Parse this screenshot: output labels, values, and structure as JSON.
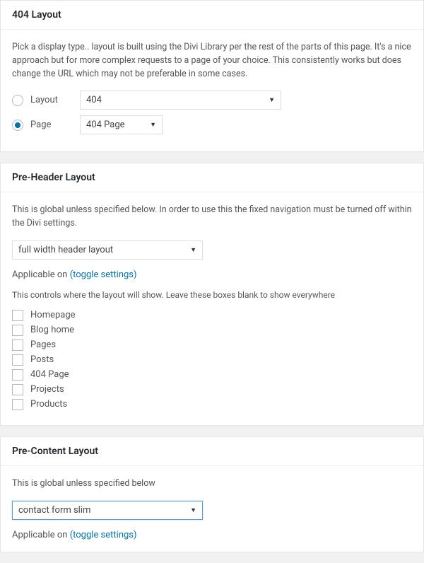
{
  "section404": {
    "title": "404 Layout",
    "description": "Pick a display type.. layout is built using the Divi Library per the rest of the parts of this page. It's a nice approach but for more complex requests to a page of your choice. This consistently works but does change the URL which may not be preferable in some cases.",
    "radioLayout": "Layout",
    "radioPage": "Page",
    "selectLayoutValue": "404",
    "selectPageValue": "404 Page"
  },
  "preHeader": {
    "title": "Pre-Header Layout",
    "description": "This is global unless specified below. In order to use this the fixed navigation must be turned off within the Divi settings.",
    "selectValue": "full width header layout",
    "applicablePrefix": "Applicable on ",
    "toggleText": "(toggle settings)",
    "applicableDesc": "This controls where the layout will show. Leave these boxes blank to show everywhere",
    "checkboxes": [
      "Homepage",
      "Blog home",
      "Pages",
      "Posts",
      "404 Page",
      "Projects",
      "Products"
    ]
  },
  "preContent": {
    "title": "Pre-Content Layout",
    "description": "This is global unless specified below",
    "selectValue": "contact form slim",
    "applicablePrefix": "Applicable on ",
    "toggleText": "(toggle settings)"
  }
}
